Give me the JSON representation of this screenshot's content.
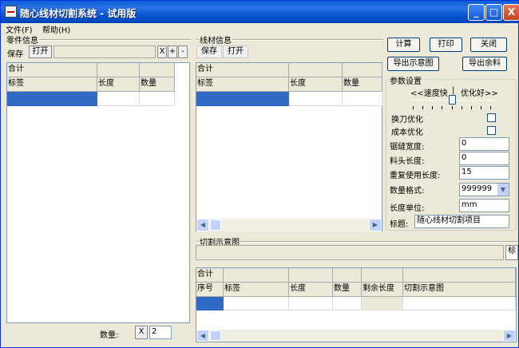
{
  "title": "随心线材切割系统 - 试用版",
  "window_controls": {
    "minimize": "_",
    "maximize": "□",
    "close": "X"
  },
  "menu": [
    {
      "label": "文件(F)"
    },
    {
      "label": "帮助(H)"
    }
  ],
  "parts": {
    "title": "零件信息",
    "save": "保存",
    "open": "打开",
    "x": "X",
    "plus": "+",
    "minus": "-",
    "total": "合计",
    "columns": [
      "标签",
      "长度",
      "数量"
    ],
    "qty_label": "数量:",
    "qty_x": "X",
    "qty_value": "2"
  },
  "wire": {
    "title": "线材信息",
    "save": "保存",
    "open": "打开",
    "total": "合计",
    "columns": [
      "标签",
      "长度",
      "数量"
    ]
  },
  "actions": {
    "calc": "计算",
    "print": "打印",
    "close": "关闭",
    "export_diagram": "导出示意图",
    "export_rest": "导出余料"
  },
  "params": {
    "title": "参数设置",
    "speed_fast": "<<速度快",
    "divider": "|",
    "opt_good": "优化好>>",
    "slider_position": 0.5,
    "tool_change": "换刀优化",
    "cost_opt": "成本优化",
    "kerf_label": "锯缝宽度:",
    "kerf_value": "0",
    "head_label": "料头长度:",
    "head_value": "0",
    "reuse_label": "重复使用长度:",
    "reuse_value": "15",
    "qty_fmt_label": "数量格式:",
    "qty_fmt_value": "999999",
    "unit_label": "长度单位:",
    "unit_value": "mm",
    "title_label": "标题:",
    "title_value": "随心线材切割项目"
  },
  "cut": {
    "title": "切割示意图",
    "side_tab": "标",
    "total": "合计",
    "columns": [
      "序号",
      "标签",
      "长度",
      "数量",
      "剩余长度",
      "切割示意图"
    ]
  }
}
